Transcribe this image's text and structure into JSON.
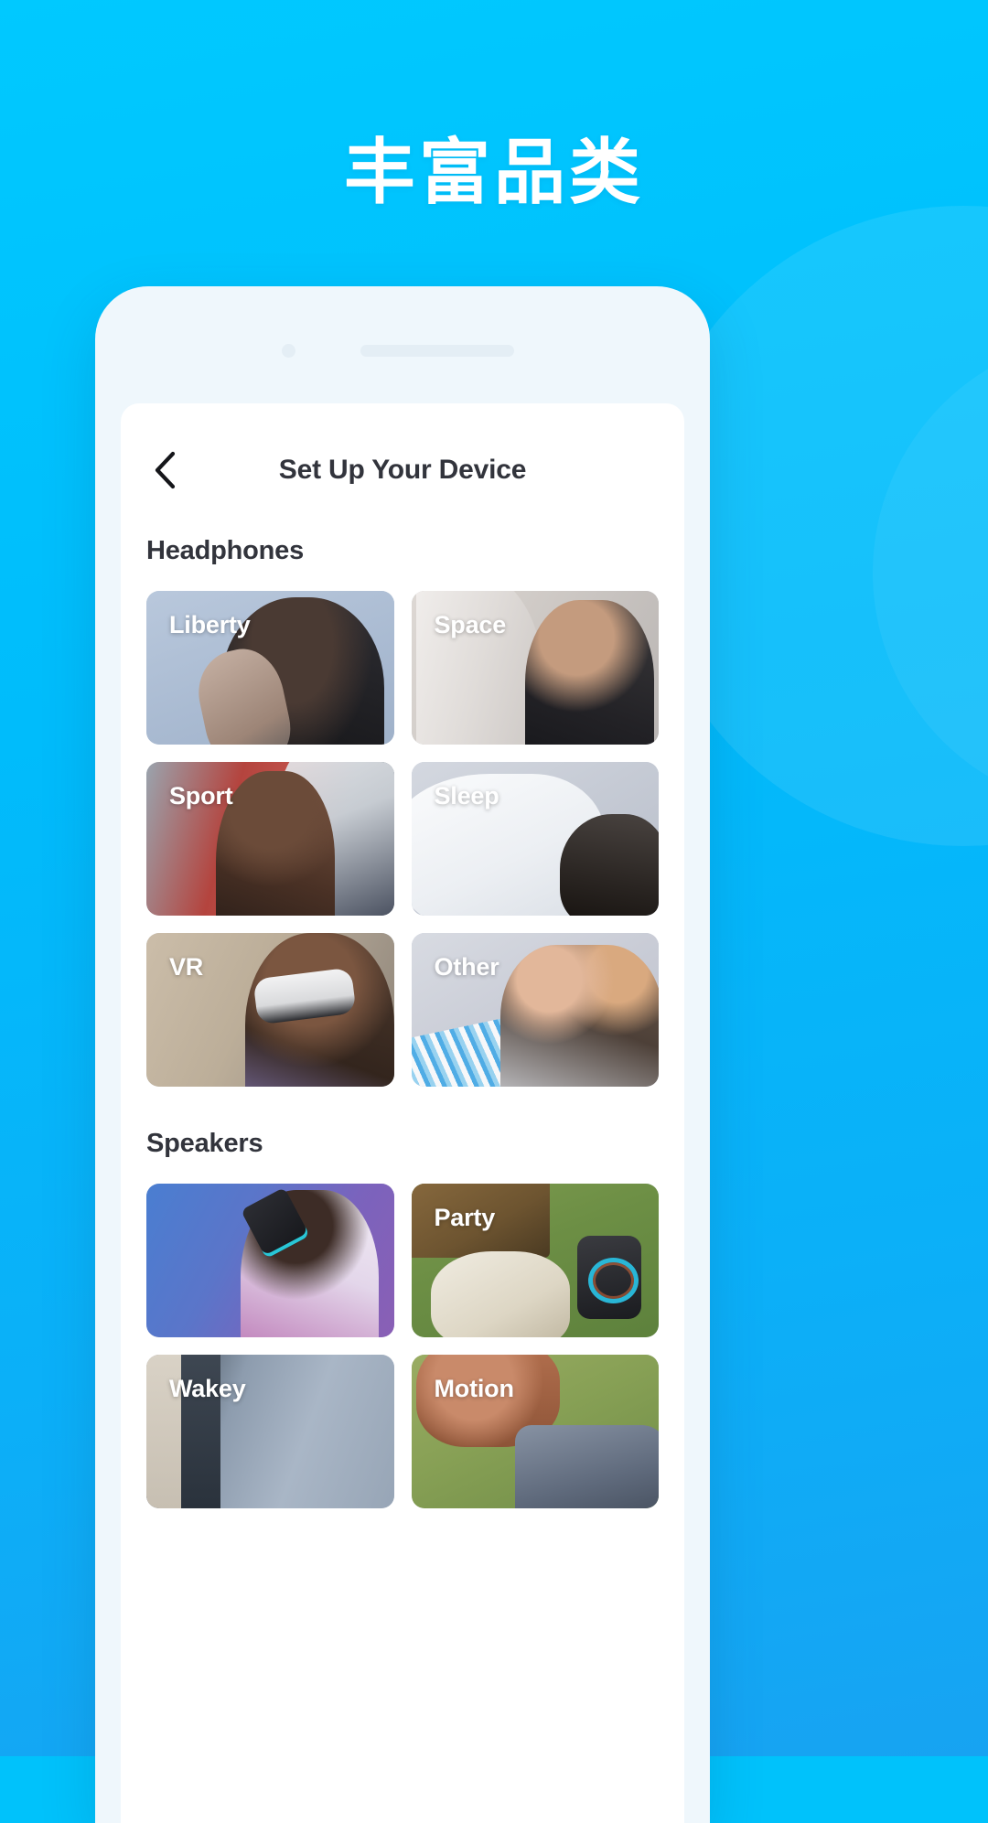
{
  "hero": {
    "title": "丰富品类"
  },
  "phone": {
    "speaker_slot": "earpiece-speaker",
    "camera": "front-camera"
  },
  "app": {
    "navbar": {
      "back_icon": "chevron-left-icon",
      "title": "Set Up Your Device"
    },
    "sections": [
      {
        "title": "Headphones",
        "cards": [
          {
            "label": "Liberty",
            "art": "art-liberty"
          },
          {
            "label": "Space",
            "art": "art-space"
          },
          {
            "label": "Sport",
            "art": "art-sport"
          },
          {
            "label": "Sleep",
            "art": "art-sleep"
          },
          {
            "label": "VR",
            "art": "art-vr"
          },
          {
            "label": "Other",
            "art": "art-other"
          }
        ]
      },
      {
        "title": "Speakers",
        "cards": [
          {
            "label": "",
            "art": "art-boom"
          },
          {
            "label": "Party",
            "art": "art-party"
          },
          {
            "label": "Wakey",
            "art": "art-wakey"
          },
          {
            "label": "Motion",
            "art": "art-motion"
          }
        ]
      }
    ]
  },
  "colors": {
    "background_top": "#00c9ff",
    "background_bottom": "#17a3f2",
    "phone_frame": "#eff7fc",
    "screen": "#ffffff",
    "text_dark": "#32343c",
    "text_light": "#ffffff"
  }
}
